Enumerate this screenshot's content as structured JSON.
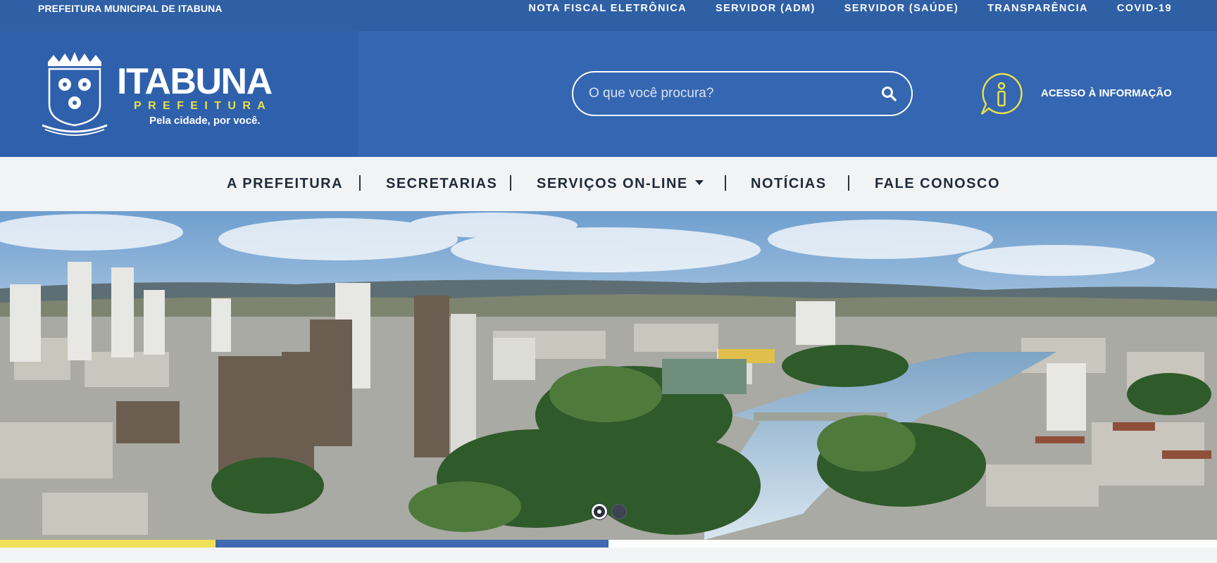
{
  "topbar": {
    "site_name": "PREFEITURA MUNICIPAL DE ITABUNA",
    "links": [
      "NOTA FISCAL ELETRÔNICA",
      "SERVIDOR (ADM)",
      "SERVIDOR (SAÚDE)",
      "TRANSPARÊNCIA",
      "COVID-19"
    ]
  },
  "header": {
    "title": "ITABUNA",
    "subtitle": "PREFEITURA",
    "slogan": "Pela cidade, por você.",
    "search_placeholder": "O que você procura?",
    "access_label": "ACESSO À INFORMAÇÃO"
  },
  "nav": {
    "items": [
      "A PREFEITURA",
      "SECRETARIAS",
      "SERVIÇOS ON-LINE",
      "NOTÍCIAS",
      "FALE CONOSCO"
    ]
  },
  "carousel": {
    "slides": 2,
    "active_slide": 1,
    "progress_yellow_fraction": 0.177,
    "progress_blue_fraction": 0.323
  },
  "colors": {
    "topbar": "#2f5fa5",
    "header": "#3566b1",
    "accent_yellow": "#f1e05a",
    "accent_blue": "#3f69b0"
  },
  "icons": {
    "search": "search-icon",
    "info": "info-icon",
    "dropdown": "chevron-down-icon",
    "crest": "crest-icon"
  }
}
